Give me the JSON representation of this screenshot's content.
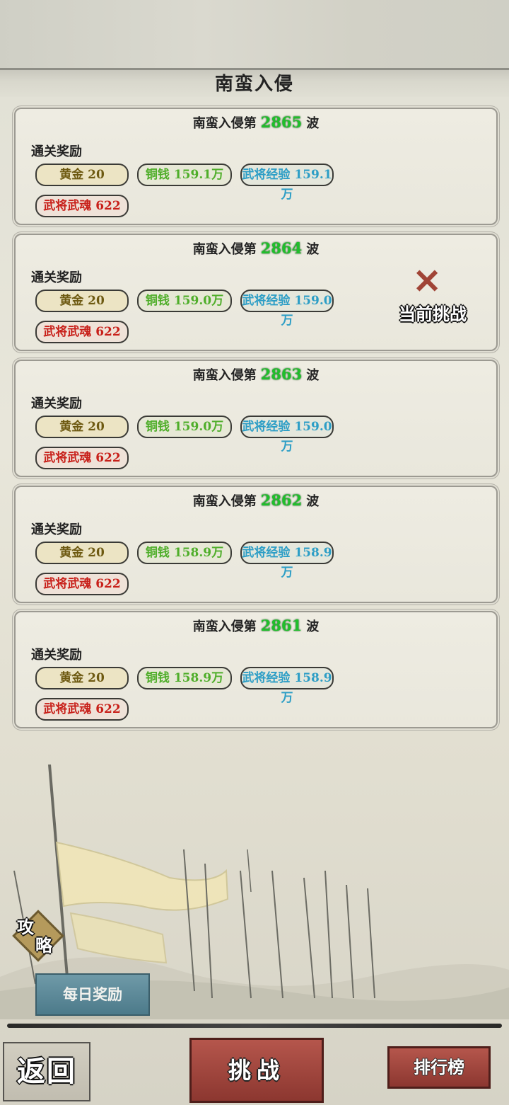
{
  "header": {
    "title": "南蛮入侵"
  },
  "waves": [
    {
      "prefix": "南蛮入侵第",
      "number": "2865",
      "suffix": "波",
      "reward_label": "通关奖励",
      "rewards": {
        "gold": "黄金 20",
        "coin": "铜钱 159.1万",
        "exp": "武将经验 159.1万",
        "soul": "武将武魂 622"
      }
    },
    {
      "prefix": "南蛮入侵第",
      "number": "2864",
      "suffix": "波",
      "reward_label": "通关奖励",
      "rewards": {
        "gold": "黄金 20",
        "coin": "铜钱 159.0万",
        "exp": "武将经验 159.0万",
        "soul": "武将武魂 622"
      },
      "current_label": "当前挑战"
    },
    {
      "prefix": "南蛮入侵第",
      "number": "2863",
      "suffix": "波",
      "reward_label": "通关奖励",
      "rewards": {
        "gold": "黄金 20",
        "coin": "铜钱 159.0万",
        "exp": "武将经验 159.0万",
        "soul": "武将武魂 622"
      }
    },
    {
      "prefix": "南蛮入侵第",
      "number": "2862",
      "suffix": "波",
      "reward_label": "通关奖励",
      "rewards": {
        "gold": "黄金 20",
        "coin": "铜钱 158.9万",
        "exp": "武将经验 158.9万",
        "soul": "武将武魂 622"
      }
    },
    {
      "prefix": "南蛮入侵第",
      "number": "2861",
      "suffix": "波",
      "reward_label": "通关奖励",
      "rewards": {
        "gold": "黄金 20",
        "coin": "铜钱 158.9万",
        "exp": "武将经验 158.9万",
        "soul": "武将武魂 622"
      }
    }
  ],
  "side": {
    "strategy_1": "攻",
    "strategy_2": "略",
    "daily_reward": "每日奖励"
  },
  "footer": {
    "back": "返回",
    "challenge": "挑战",
    "rank": "排行榜"
  },
  "colors": {
    "wave_number": "#1fbf2b",
    "gold": "#6e5a12",
    "coin": "#4fae2a",
    "exp": "#2d9ec6",
    "soul": "#c8201a",
    "button_red": "#9e463e"
  }
}
